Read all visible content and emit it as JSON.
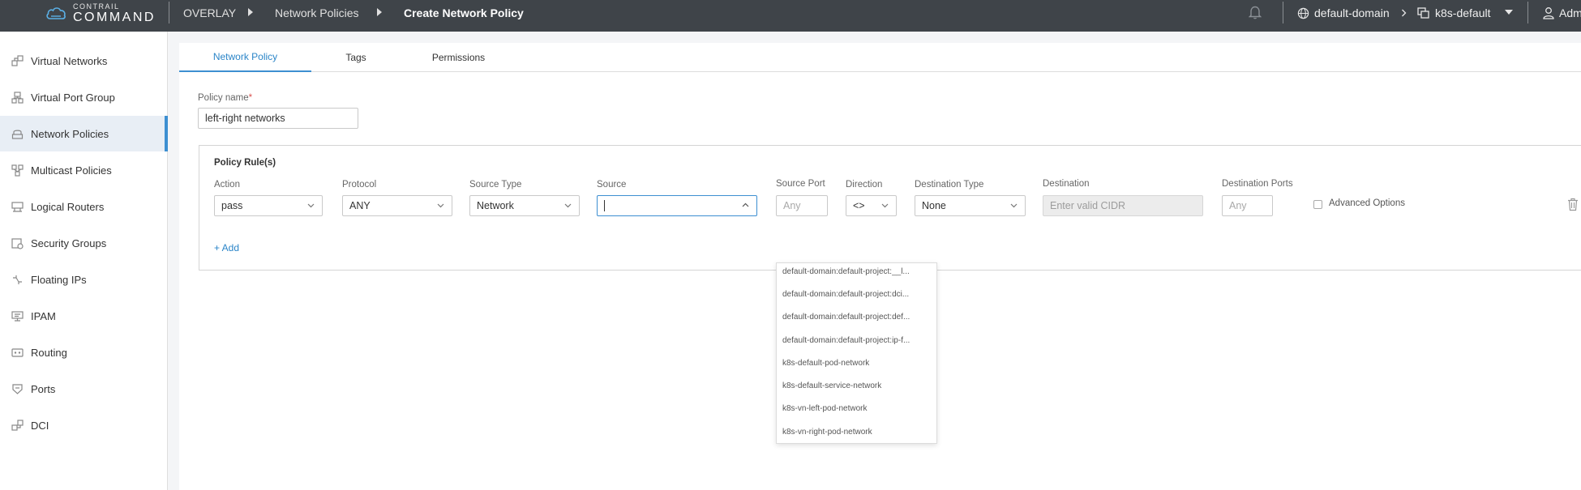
{
  "app": {
    "logo_small": "CONTRAIL",
    "logo_big": "COMMAND"
  },
  "breadcrumbs": [
    {
      "label": "OVERLAY"
    },
    {
      "label": "Network Policies"
    },
    {
      "label": "Create Network Policy"
    }
  ],
  "topbar": {
    "domain": "default-domain",
    "project": "k8s-default",
    "user": "Adm"
  },
  "sidebar": {
    "items": [
      {
        "label": "Virtual Networks",
        "icon": "virtual-networks-icon"
      },
      {
        "label": "Virtual Port Group",
        "icon": "port-group-icon"
      },
      {
        "label": "Network Policies",
        "icon": "network-policies-icon",
        "active": true
      },
      {
        "label": "Multicast Policies",
        "icon": "multicast-icon"
      },
      {
        "label": "Logical Routers",
        "icon": "router-icon"
      },
      {
        "label": "Security Groups",
        "icon": "security-groups-icon"
      },
      {
        "label": "Floating IPs",
        "icon": "floating-ips-icon"
      },
      {
        "label": "IPAM",
        "icon": "ipam-icon"
      },
      {
        "label": "Routing",
        "icon": "routing-icon"
      },
      {
        "label": "Ports",
        "icon": "ports-icon"
      },
      {
        "label": "DCI",
        "icon": "dci-icon"
      }
    ]
  },
  "tabs": [
    {
      "label": "Network Policy",
      "active": true
    },
    {
      "label": "Tags"
    },
    {
      "label": "Permissions"
    }
  ],
  "form": {
    "policy_name_label": "Policy name",
    "required_mark": "*",
    "policy_name_value": "left-right networks",
    "rules_title": "Policy Rule(s)",
    "add_label": "+ Add",
    "action_label": "Action",
    "action_value": "pass",
    "protocol_label": "Protocol",
    "protocol_value": "ANY",
    "source_type_label": "Source Type",
    "source_type_value": "Network",
    "source_label": "Source",
    "source_value": "",
    "source_port_label": "Source Port",
    "source_port_placeholder": "Any",
    "direction_label": "Direction",
    "direction_value": "<>",
    "dest_type_label": "Destination Type",
    "dest_type_value": "None",
    "destination_label": "Destination",
    "destination_placeholder": "Enter valid CIDR",
    "dest_ports_label": "Destination Ports",
    "dest_ports_placeholder": "Any",
    "advanced_label": "Advanced Options"
  },
  "source_dropdown": {
    "options": [
      "default-domain:default-project:__l...",
      "default-domain:default-project:dci...",
      "default-domain:default-project:def...",
      "default-domain:default-project:ip-f...",
      "k8s-default-pod-network",
      "k8s-default-service-network",
      "k8s-vn-left-pod-network",
      "k8s-vn-right-pod-network"
    ]
  },
  "colors": {
    "topbar": "#3f4449",
    "accent": "#3d8fd1",
    "active_tab_text": "#2b85c8",
    "sidebar_active_bg": "#e8eef5"
  }
}
